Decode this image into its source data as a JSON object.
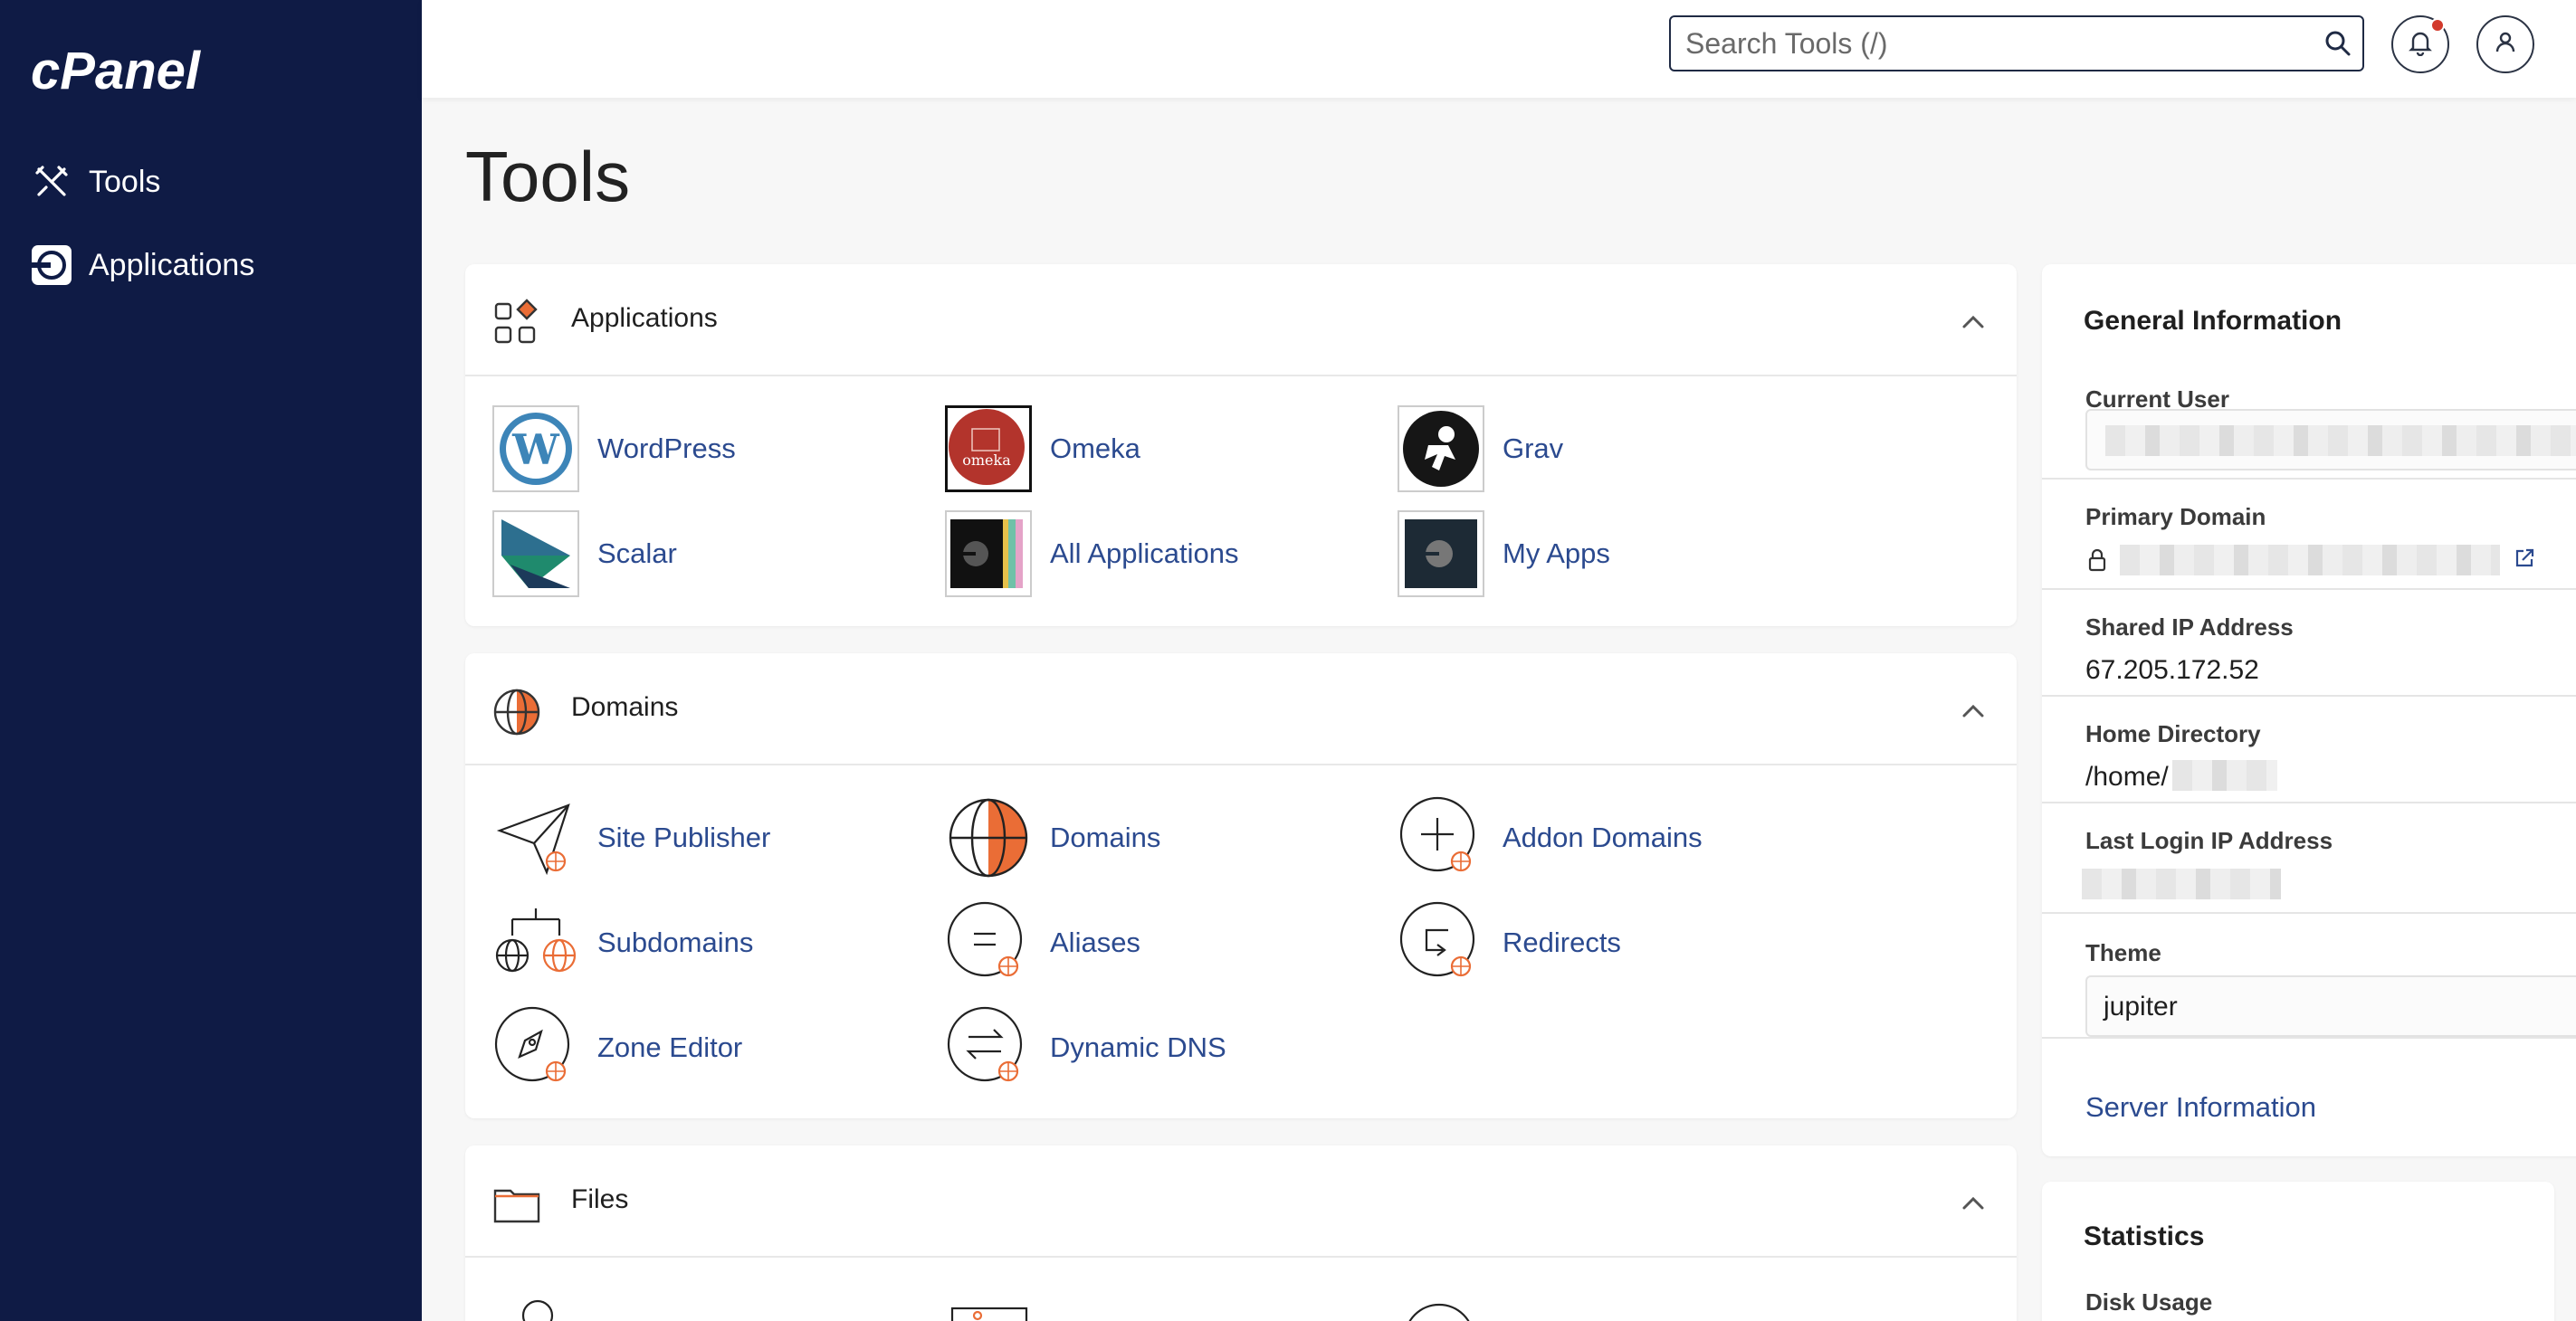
{
  "brand": {
    "logo_text": "cPanel"
  },
  "sidebar": {
    "items": [
      {
        "label": "Tools",
        "icon": "tools-icon"
      },
      {
        "label": "Applications",
        "icon": "applications-icon"
      }
    ]
  },
  "topbar": {
    "search_placeholder": "Search Tools (/)",
    "search_icon": "search-icon",
    "notifications_icon": "bell-icon",
    "user_icon": "user-icon"
  },
  "page": {
    "title": "Tools"
  },
  "sections": {
    "applications": {
      "title": "Applications",
      "tools": [
        {
          "label": "WordPress"
        },
        {
          "label": "Omeka"
        },
        {
          "label": "Grav"
        },
        {
          "label": "Scalar"
        },
        {
          "label": "All Applications"
        },
        {
          "label": "My Apps"
        }
      ],
      "omeka_logo_text": "omeka"
    },
    "domains": {
      "title": "Domains",
      "tools": [
        {
          "label": "Site Publisher"
        },
        {
          "label": "Domains"
        },
        {
          "label": "Addon Domains"
        },
        {
          "label": "Subdomains"
        },
        {
          "label": "Aliases"
        },
        {
          "label": "Redirects"
        },
        {
          "label": "Zone Editor"
        },
        {
          "label": "Dynamic DNS"
        }
      ]
    },
    "files": {
      "title": "Files"
    }
  },
  "general_info": {
    "title": "General Information",
    "current_user_label": "Current User",
    "current_user_suffix": "..",
    "primary_domain_label": "Primary Domain",
    "shared_ip_label": "Shared IP Address",
    "shared_ip_value": "67.205.172.52",
    "home_dir_label": "Home Directory",
    "home_dir_value": "/home/",
    "last_login_label": "Last Login IP Address",
    "theme_label": "Theme",
    "theme_value": "jupiter",
    "server_info_link": "Server Information"
  },
  "statistics": {
    "title": "Statistics",
    "disk_usage_label": "Disk Usage"
  },
  "colors": {
    "sidebar_bg": "#0f1b45",
    "link_blue": "#2b4a8f",
    "accent_orange": "#ea6d36",
    "notification_red": "#d23a2c"
  }
}
